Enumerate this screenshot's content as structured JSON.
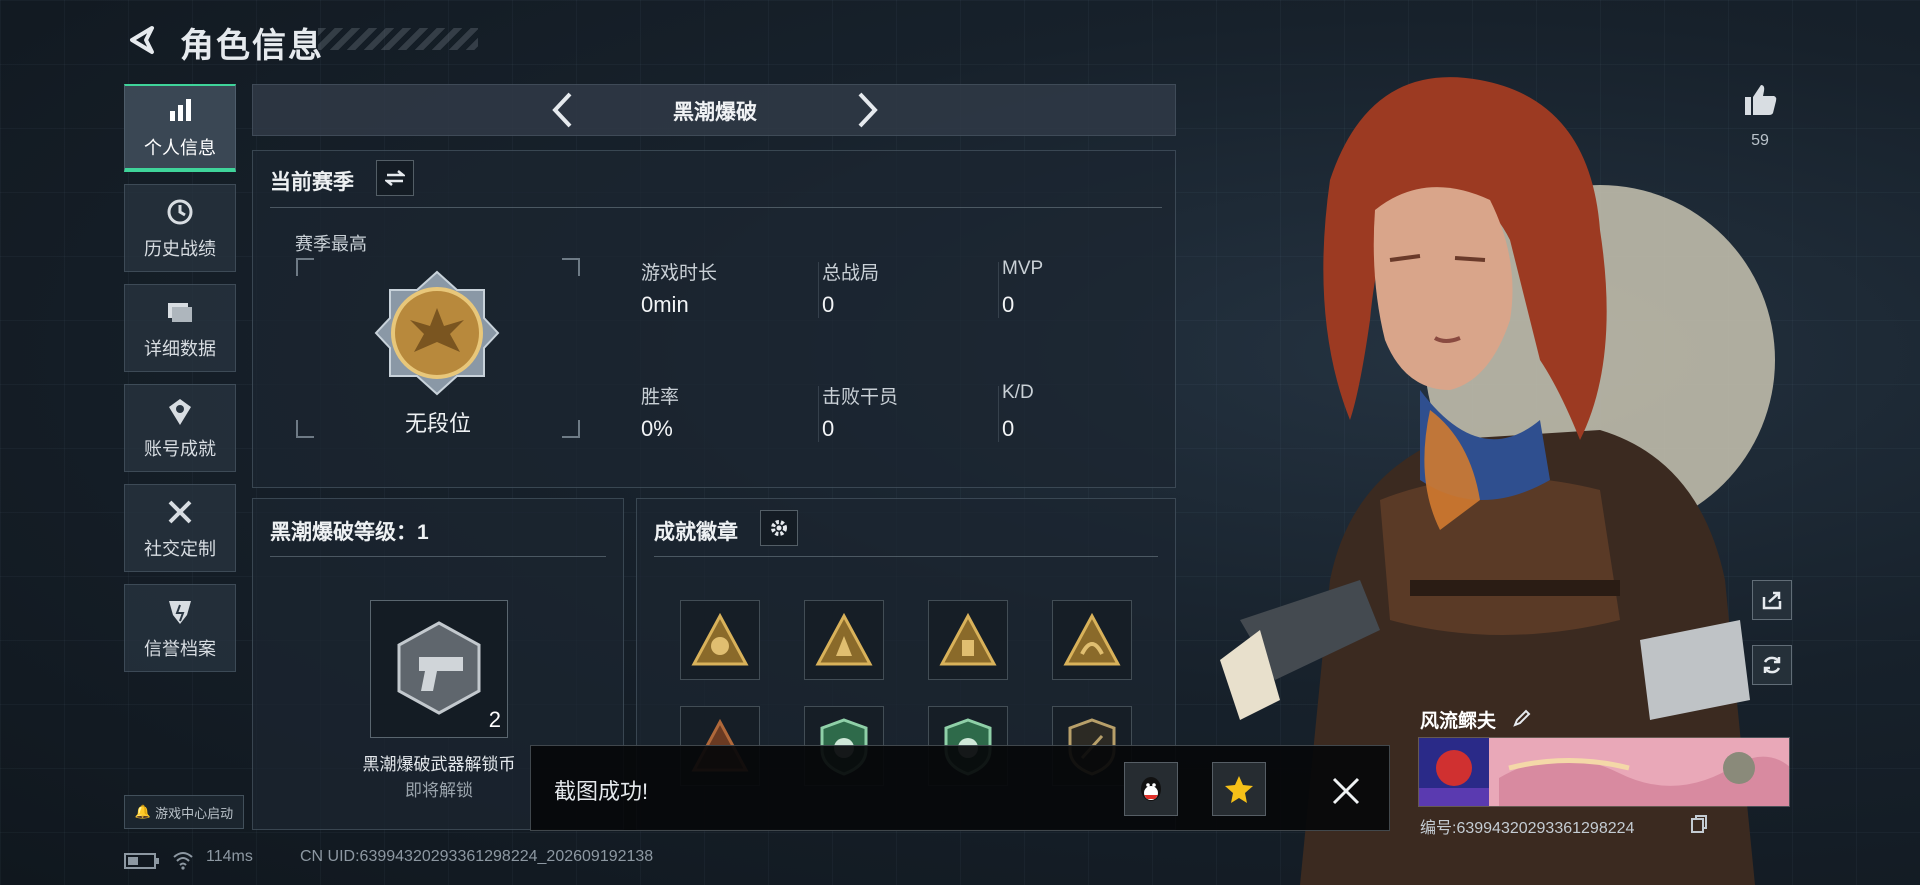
{
  "header": {
    "title": "角色信息"
  },
  "nav": {
    "items": [
      {
        "label": "个人信息",
        "icon": "bar-chart-icon",
        "active": true
      },
      {
        "label": "历史战绩",
        "icon": "history-icon",
        "active": false
      },
      {
        "label": "详细数据",
        "icon": "folder-icon",
        "active": false
      },
      {
        "label": "账号成就",
        "icon": "achievement-icon",
        "active": false
      },
      {
        "label": "社交定制",
        "icon": "tools-icon",
        "active": false
      },
      {
        "label": "信誉档案",
        "icon": "credit-shield-icon",
        "active": false
      }
    ],
    "game_center": "游戏中心启动"
  },
  "mode": {
    "name": "黑潮爆破"
  },
  "season": {
    "title": "当前赛季",
    "best_label": "赛季最高",
    "rank": "无段位",
    "stats": [
      {
        "label": "游戏时长",
        "value": "0min"
      },
      {
        "label": "总战局",
        "value": "0"
      },
      {
        "label": "MVP",
        "value": "0"
      },
      {
        "label": "胜率",
        "value": "0%"
      },
      {
        "label": "击败干员",
        "value": "0"
      },
      {
        "label": "K/D",
        "value": "0"
      }
    ]
  },
  "level": {
    "title": "黑潮爆破等级：1",
    "reward_count": "2",
    "reward_name": "黑潮爆破武器解锁币",
    "reward_status": "即将解锁"
  },
  "badges": {
    "title": "成就徽章"
  },
  "toast": {
    "text": "截图成功!"
  },
  "status": {
    "ping": "114ms",
    "uid": "CN UID:6399432029336129822​4_202609192138"
  },
  "profile": {
    "likes": "59",
    "name": "风流鳏夫",
    "id_text": "编号:6399432029336129822​4"
  },
  "colors": {
    "accent": "#3fd49a",
    "gold": "#c9a050",
    "panel": "#1c2630"
  }
}
